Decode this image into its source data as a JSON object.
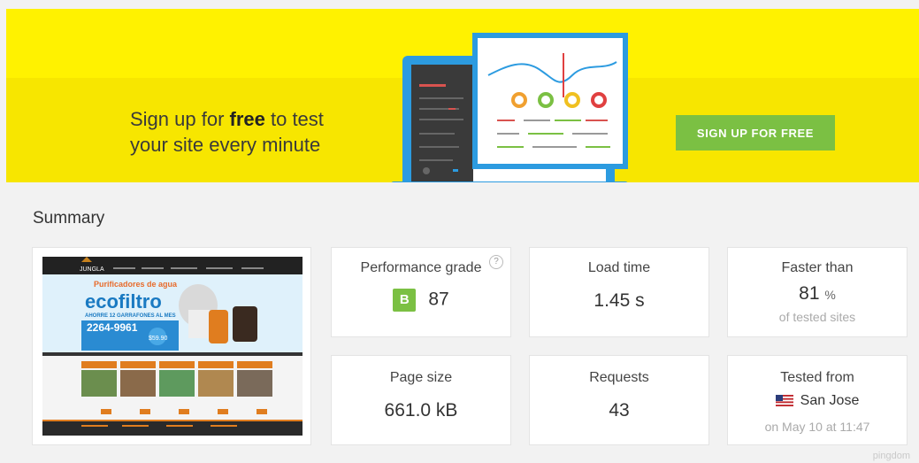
{
  "banner": {
    "text_pre": "Sign up for ",
    "text_bold": "free",
    "text_post": " to test your site every minute",
    "button_label": "SIGN UP FOR FREE",
    "accent": "#fff200",
    "button_color": "#7bc043"
  },
  "summary": {
    "title": "Summary",
    "thumbnail": {
      "brand": "JUNGLA",
      "headline": "Purificadores de agua",
      "logo": "ecofiltro",
      "promo": "AHORRE 12 GARRAFONES AL MES",
      "phone": "2264-9961",
      "price": "$59.90"
    },
    "performance": {
      "label": "Performance grade",
      "grade": "B",
      "score": "87",
      "help_icon": "question-icon"
    },
    "load_time": {
      "label": "Load time",
      "value": "1.45 s"
    },
    "faster_than": {
      "label": "Faster than",
      "value": "81",
      "unit": "%",
      "sub": "of tested sites"
    },
    "page_size": {
      "label": "Page size",
      "value": "661.0 kB"
    },
    "requests": {
      "label": "Requests",
      "value": "43"
    },
    "tested_from": {
      "label": "Tested from",
      "location": "San Jose",
      "date": "on May 10 at 11:47",
      "flag_icon": "us-flag-icon"
    }
  },
  "footer": {
    "watermark": "pingdom"
  }
}
